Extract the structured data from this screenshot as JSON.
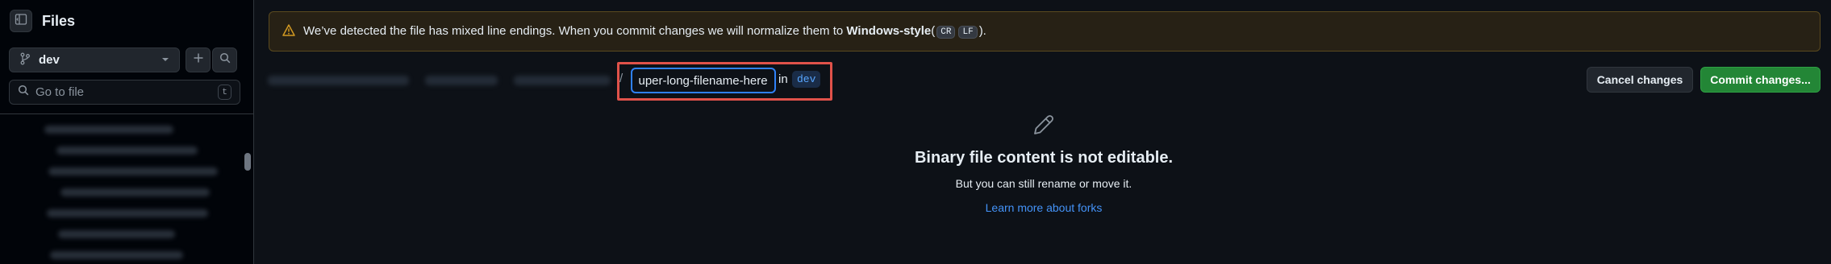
{
  "sidebar": {
    "title": "Files",
    "branch": "dev",
    "goto_placeholder": "Go to file",
    "goto_shortcut": "t"
  },
  "banner": {
    "text_before": "We’ve detected the file has mixed line endings. When you commit changes we will normalize them to ",
    "style_name": "Windows-style",
    "paren_open": "(",
    "cr": "CR",
    "lf": "LF",
    "paren_close": ")."
  },
  "editor": {
    "separator": "/",
    "filename_value": "super-long-filename-here",
    "in_label": "in",
    "branch": "dev"
  },
  "actions": {
    "cancel": "Cancel changes",
    "commit": "Commit changes..."
  },
  "empty_state": {
    "title": "Binary file content is not editable.",
    "subtitle": "But you can still rename or move it.",
    "link": "Learn more about forks"
  },
  "colors": {
    "accent_blue": "#2f81f7",
    "commit_green": "#238636",
    "highlight_red": "#e0524a",
    "warning_yellow": "#d29922"
  },
  "icons": [
    "sidebar-toggle-icon",
    "git-branch-icon",
    "chevron-down-icon",
    "plus-icon",
    "search-icon",
    "alert-icon",
    "pencil-icon"
  ]
}
